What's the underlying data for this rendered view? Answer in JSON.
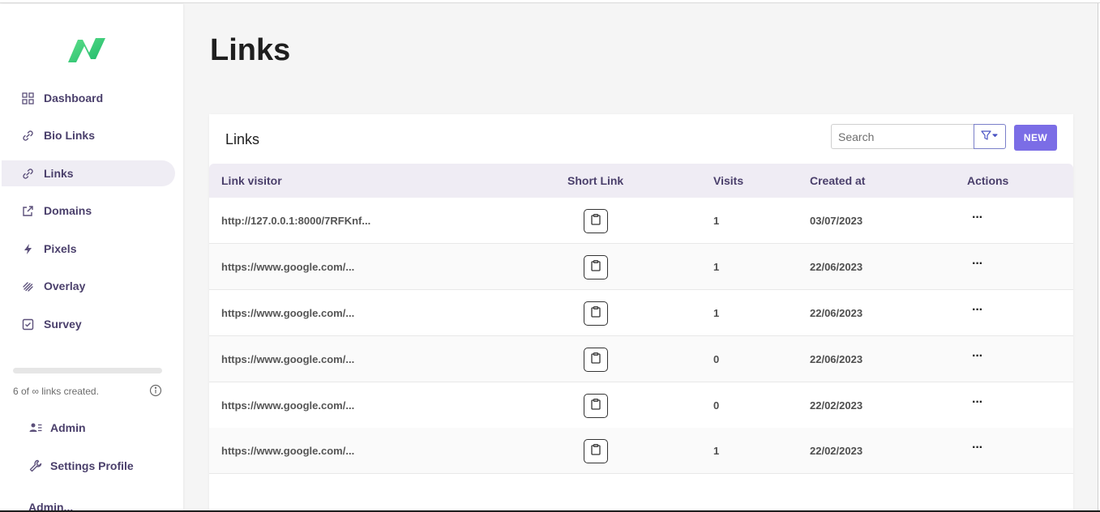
{
  "sidebar": {
    "nav": [
      {
        "label": "Dashboard",
        "icon": "grid-icon",
        "active": false
      },
      {
        "label": "Bio Links",
        "icon": "link-icon",
        "active": false
      },
      {
        "label": "Links",
        "icon": "link-icon",
        "active": true
      },
      {
        "label": "Domains",
        "icon": "external-link-icon",
        "active": false
      },
      {
        "label": "Pixels",
        "icon": "lightning-icon",
        "active": false
      },
      {
        "label": "Overlay",
        "icon": "layers-icon",
        "active": false
      },
      {
        "label": "Survey",
        "icon": "checkbox-icon",
        "active": false
      }
    ],
    "usage_text": "6 of ∞ links created.",
    "admin_label": "Admin",
    "settings_label": "Settings Profile",
    "user_label": "Admin..."
  },
  "page": {
    "title": "Links"
  },
  "card": {
    "title": "Links",
    "search_placeholder": "Search",
    "new_label": "NEW",
    "columns": [
      "Link visitor",
      "Short Link",
      "Visits",
      "Created at",
      "Actions"
    ],
    "rows": [
      {
        "link": "http://127.0.0.1:8000/7RFKnf...",
        "visits": "1",
        "created": "03/07/2023",
        "actions": "···"
      },
      {
        "link": "https://www.google.com/...",
        "visits": "1",
        "created": "22/06/2023",
        "actions": "···"
      },
      {
        "link": "https://www.google.com/...",
        "visits": "1",
        "created": "22/06/2023",
        "actions": "···"
      },
      {
        "link": "https://www.google.com/...",
        "visits": "0",
        "created": "22/06/2023",
        "actions": "···"
      },
      {
        "link": "https://www.google.com/...",
        "visits": "0",
        "created": "22/02/2023",
        "actions": "···"
      },
      {
        "link": "https://www.google.com/...",
        "visits": "1",
        "created": "22/02/2023",
        "actions": "···"
      }
    ]
  },
  "colors": {
    "accent": "#7b6de6",
    "logo_green": "#2ecc71",
    "nav_text": "#4a3f6b"
  }
}
